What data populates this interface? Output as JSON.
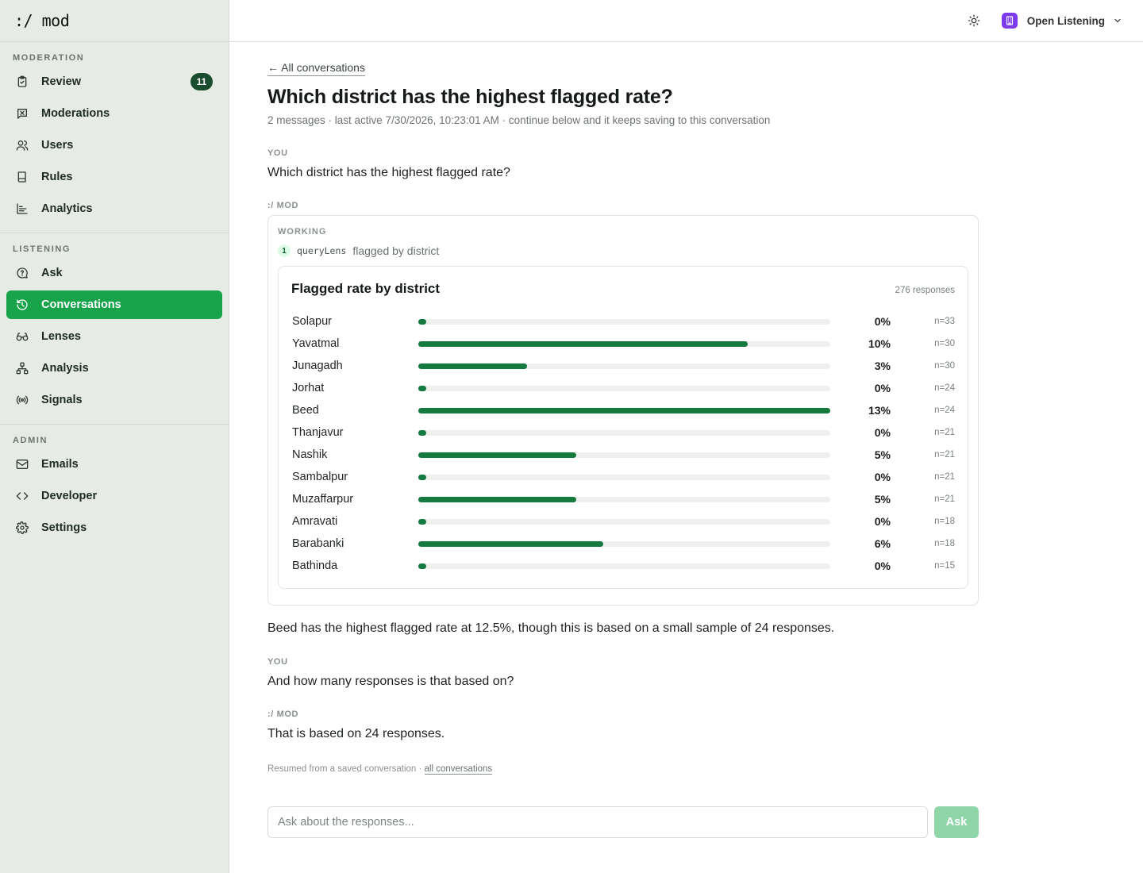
{
  "brand": ":/ mod",
  "sidebar": {
    "sections": [
      {
        "title": "MODERATION",
        "items": [
          {
            "label": "Review",
            "icon": "clipboard-check-icon",
            "badge": "11"
          },
          {
            "label": "Moderations",
            "icon": "flag-square-icon"
          },
          {
            "label": "Users",
            "icon": "users-icon"
          },
          {
            "label": "Rules",
            "icon": "book-icon"
          },
          {
            "label": "Analytics",
            "icon": "bar-chart-icon"
          }
        ]
      },
      {
        "title": "LISTENING",
        "items": [
          {
            "label": "Ask",
            "icon": "message-question-icon"
          },
          {
            "label": "Conversations",
            "icon": "history-icon",
            "active": true
          },
          {
            "label": "Lenses",
            "icon": "glasses-icon"
          },
          {
            "label": "Analysis",
            "icon": "network-icon"
          },
          {
            "label": "Signals",
            "icon": "radio-icon"
          }
        ]
      },
      {
        "title": "ADMIN",
        "items": [
          {
            "label": "Emails",
            "icon": "mail-icon"
          },
          {
            "label": "Developer",
            "icon": "code-icon"
          },
          {
            "label": "Settings",
            "icon": "gear-icon"
          }
        ]
      }
    ]
  },
  "topbar": {
    "theme_icon": "sun-icon",
    "org_name": "Open Listening",
    "org_icon": "building-icon"
  },
  "main": {
    "back_link": "← All conversations",
    "title": "Which district has the highest flagged rate?",
    "meta": "2 messages · last active 7/30/2026, 10:23:01 AM · continue below and it keeps saving to this conversation",
    "messages": [
      {
        "role": "YOU",
        "text": "Which district has the highest flagged rate?"
      },
      {
        "role": ":/ MOD",
        "working_label": "WORKING",
        "step_num": "1",
        "step_tool": "queryLens",
        "step_desc": "flagged by district",
        "answer": "Beed has the highest flagged rate at 12.5%, though this is based on a small sample of 24 responses."
      },
      {
        "role": "YOU",
        "text": "And how many responses is that based on?"
      },
      {
        "role": ":/ MOD",
        "text": "That is based on 24 responses."
      }
    ],
    "resumed_text": "Resumed from a saved conversation · ",
    "resumed_link": "all conversations"
  },
  "ask": {
    "placeholder": "Ask about the responses...",
    "button": "Ask"
  },
  "accent_color": "#16a34a",
  "bar_color": "#157a3e",
  "chart_data": {
    "type": "bar",
    "orientation": "horizontal",
    "title": "Flagged rate by district",
    "total_label": "276 responses",
    "max_value": 12.5,
    "rows": [
      {
        "category": "Solapur",
        "value": 0,
        "label": "0%",
        "n": "n=33"
      },
      {
        "category": "Yavatmal",
        "value": 10,
        "label": "10%",
        "n": "n=30"
      },
      {
        "category": "Junagadh",
        "value": 3.3,
        "label": "3%",
        "n": "n=30"
      },
      {
        "category": "Jorhat",
        "value": 0,
        "label": "0%",
        "n": "n=24"
      },
      {
        "category": "Beed",
        "value": 12.5,
        "label": "13%",
        "n": "n=24"
      },
      {
        "category": "Thanjavur",
        "value": 0,
        "label": "0%",
        "n": "n=21"
      },
      {
        "category": "Nashik",
        "value": 4.8,
        "label": "5%",
        "n": "n=21"
      },
      {
        "category": "Sambalpur",
        "value": 0,
        "label": "0%",
        "n": "n=21"
      },
      {
        "category": "Muzaffarpur",
        "value": 4.8,
        "label": "5%",
        "n": "n=21"
      },
      {
        "category": "Amravati",
        "value": 0,
        "label": "0%",
        "n": "n=18"
      },
      {
        "category": "Barabanki",
        "value": 5.6,
        "label": "6%",
        "n": "n=18"
      },
      {
        "category": "Bathinda",
        "value": 0,
        "label": "0%",
        "n": "n=15"
      }
    ]
  }
}
